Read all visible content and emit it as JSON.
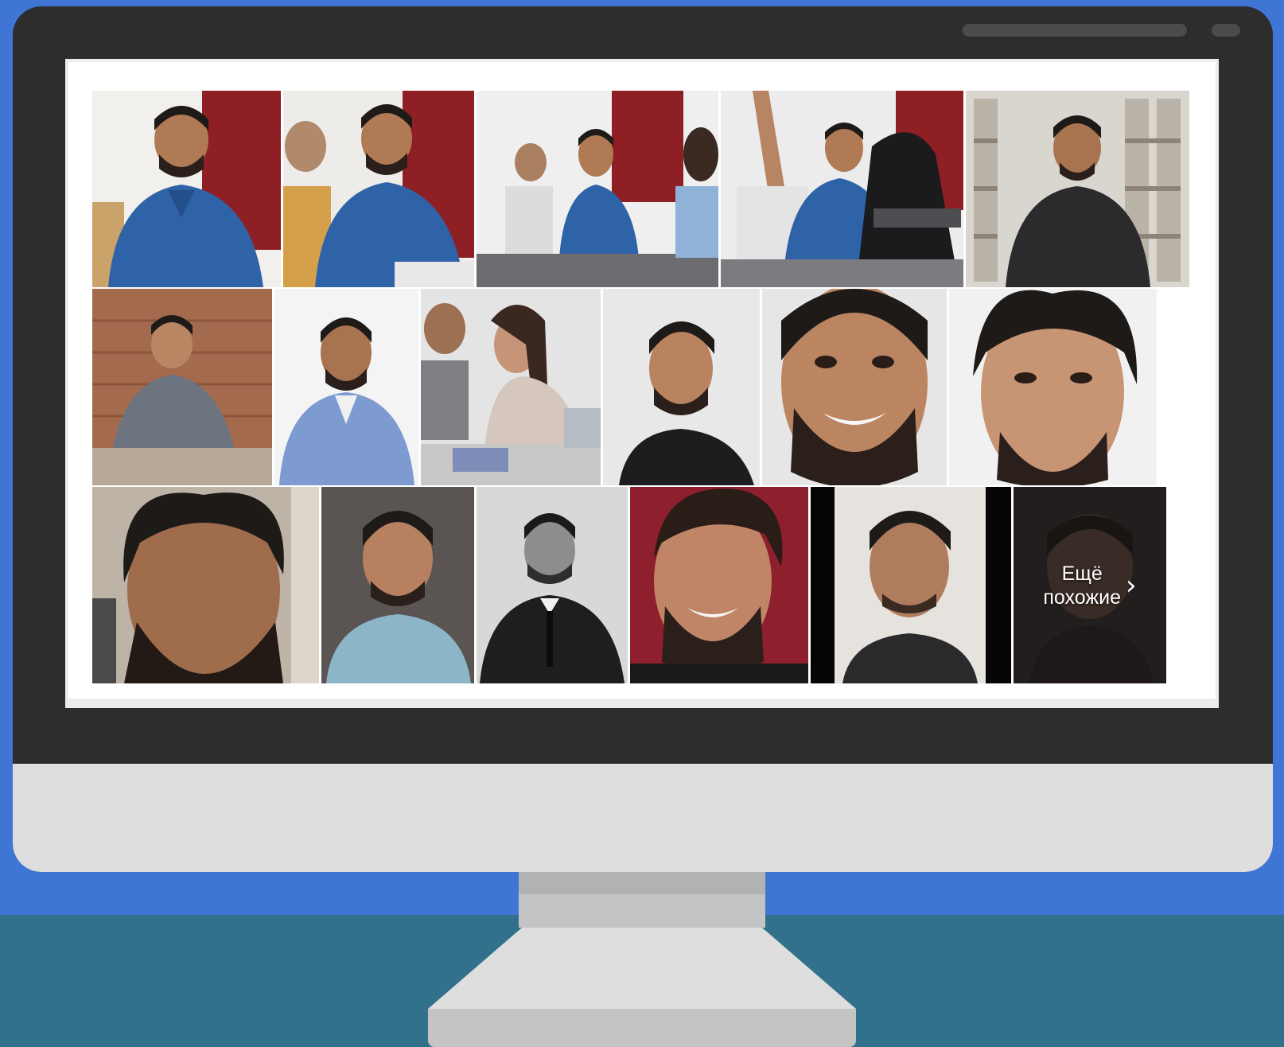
{
  "image_results": {
    "rows": [
      [
        {
          "subject": "smiling-man-classroom-red-wall"
        },
        {
          "subject": "smiling-man-classroom-red-wall"
        },
        {
          "subject": "smiling-man-classroom-wide"
        },
        {
          "subject": "students-raising-hand"
        },
        {
          "subject": "man-in-library"
        }
      ],
      [
        {
          "subject": "man-on-stairs"
        },
        {
          "subject": "man-blue-shirt-portrait"
        },
        {
          "subject": "students-studying-table"
        },
        {
          "subject": "man-dark-shirt-portrait"
        },
        {
          "subject": "man-close-up-smile"
        },
        {
          "subject": "man-close-up-portrait"
        }
      ],
      [
        {
          "subject": "man-selfie-indoor"
        },
        {
          "subject": "man-denim-shirt-portrait"
        },
        {
          "subject": "man-suit-black-white"
        },
        {
          "subject": "man-smiling-red-background"
        },
        {
          "subject": "man-video-frame"
        },
        {
          "subject": "more-similar-blurred"
        }
      ]
    ],
    "more_similar_label": "Ещё\nпохожие",
    "more_chevron": "›"
  },
  "colors": {
    "background": "#3f76d6",
    "desk": "#31718c",
    "monitor_bezel": "#2d2d2d",
    "monitor_chin": "#dedede"
  }
}
